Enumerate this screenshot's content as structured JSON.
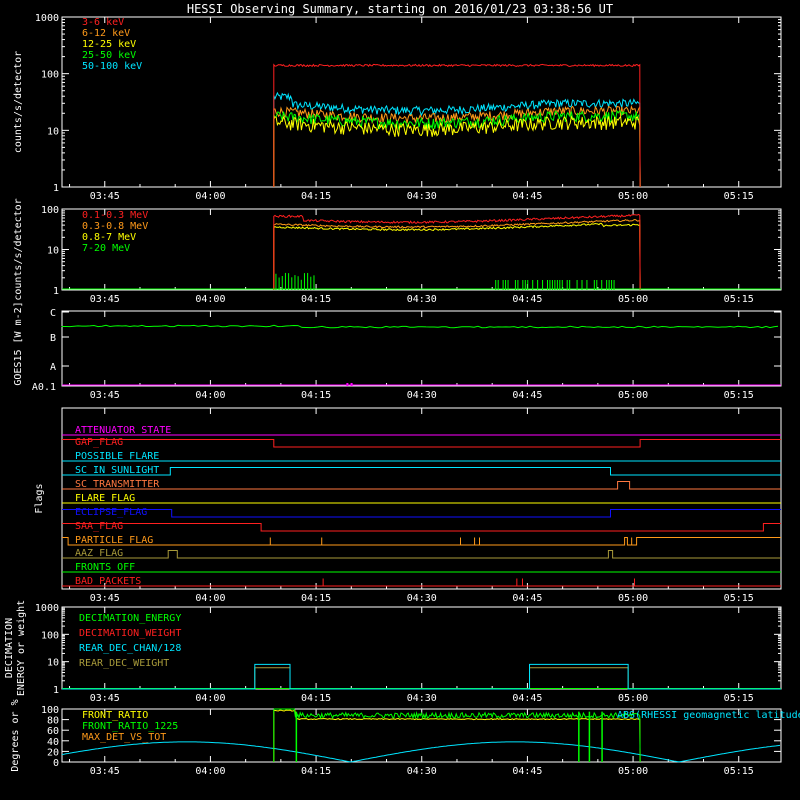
{
  "page": {
    "title": "HESSI Observing Summary, starting on 2016/01/23 03:38:56 UT"
  },
  "colors": {
    "background": "#000000",
    "axes": "#ffffff",
    "red": "#ff2020",
    "orange": "#ff9a1a",
    "yellow": "#ffff00",
    "green": "#00ff00",
    "cyan": "#00e5ff",
    "magenta": "#ff00ff",
    "blue": "#1010ff",
    "olive": "#a89a3a",
    "coral": "#ff7840"
  },
  "chart_data": [
    {
      "id": "lightcurve-low",
      "type": "line",
      "ylabel": "counts/s/detector",
      "yscale": "log",
      "ylim": [
        1,
        1000
      ],
      "yticks": [
        "1",
        "10",
        "100",
        "1000"
      ],
      "xticks": [
        "03:45",
        "04:00",
        "04:15",
        "04:30",
        "04:45",
        "05:00",
        "05:15"
      ],
      "xlim_minutes": [
        218.93,
        321.0
      ],
      "data_window": [
        249.0,
        301.0
      ],
      "series": [
        {
          "name": "3-6 keV",
          "color": "#ff2020",
          "level": 140
        },
        {
          "name": "6-12 keV",
          "color": "#ff9a1a",
          "level": 22
        },
        {
          "name": "12-25 keV",
          "color": "#ffff00",
          "level": 14
        },
        {
          "name": "25-50 keV",
          "color": "#00ff00",
          "level": 18
        },
        {
          "name": "50-100 keV",
          "color": "#00e5ff",
          "level": 30
        }
      ]
    },
    {
      "id": "lightcurve-high",
      "type": "line",
      "ylabel": "counts/s/detector",
      "yscale": "log",
      "ylim": [
        1,
        100
      ],
      "yticks": [
        "1",
        "10",
        "100"
      ],
      "xticks": [
        "03:45",
        "04:00",
        "04:15",
        "04:30",
        "04:45",
        "05:00",
        "05:15"
      ],
      "series": [
        {
          "name": "0.1-0.3 MeV",
          "color": "#ff2020",
          "level": 55
        },
        {
          "name": "0.3-0.8 MeV",
          "color": "#ff9a1a",
          "level": 42
        },
        {
          "name": "0.8-7 MeV",
          "color": "#ffff00",
          "level": 36
        },
        {
          "name": "7-20 MeV",
          "color": "#00ff00",
          "level": 1
        }
      ]
    },
    {
      "id": "goes",
      "type": "line",
      "ylabel": "GOES15 [W m-2]",
      "yticks": [
        "A0.1",
        "A",
        "B",
        "C"
      ],
      "xticks": [
        "03:45",
        "04:00",
        "04:15",
        "04:30",
        "04:45",
        "05:00",
        "05:15"
      ]
    },
    {
      "id": "flags",
      "type": "line",
      "ylabel": "Flags",
      "xticks": [
        "03:45",
        "04:00",
        "04:15",
        "04:30",
        "04:45",
        "05:00",
        "05:15"
      ],
      "series": [
        {
          "name": "ATTENUATOR_STATE",
          "color": "#ff00ff"
        },
        {
          "name": "GAP_FLAG",
          "color": "#ff2020"
        },
        {
          "name": "POSSIBLE_FLARE",
          "color": "#00e5ff"
        },
        {
          "name": "SC_IN_SUNLIGHT",
          "color": "#00e5ff"
        },
        {
          "name": "SC_TRANSMITTER",
          "color": "#ff7840"
        },
        {
          "name": "FLARE_FLAG",
          "color": "#ffff00"
        },
        {
          "name": "ECLIPSE_FLAG",
          "color": "#1010ff"
        },
        {
          "name": "SAA_FLAG",
          "color": "#ff2020"
        },
        {
          "name": "PARTICLE_FLAG",
          "color": "#ff9a1a"
        },
        {
          "name": "AAZ_FLAG",
          "color": "#a89a3a"
        },
        {
          "name": "FRONTS_OFF",
          "color": "#00ff00"
        },
        {
          "name": "BAD_PACKETS",
          "color": "#ff2020"
        }
      ]
    },
    {
      "id": "decimation",
      "type": "line",
      "ylabel": "DECIMATION ENERGY or weight",
      "yscale": "log",
      "ylim": [
        1,
        1000
      ],
      "yticks": [
        "1",
        "10",
        "100",
        "1000"
      ],
      "xticks": [
        "03:45",
        "04:00",
        "04:15",
        "04:30",
        "04:45",
        "05:00",
        "05:15"
      ],
      "series": [
        {
          "name": "DECIMATION_ENERGY",
          "color": "#00ff00"
        },
        {
          "name": "DECIMATION_WEIGHT",
          "color": "#ff2020"
        },
        {
          "name": "REAR_DEC_CHAN/128",
          "color": "#00e5ff"
        },
        {
          "name": "REAR_DEC_WEIGHT",
          "color": "#a89a3a"
        }
      ]
    },
    {
      "id": "ratios",
      "type": "line",
      "ylabel": "Degrees or %",
      "ylim": [
        0,
        100
      ],
      "yticks": [
        "0",
        "20",
        "40",
        "60",
        "80",
        "100"
      ],
      "xticks": [
        "03:45",
        "04:00",
        "04:15",
        "04:30",
        "04:45",
        "05:00",
        "05:15"
      ],
      "series": [
        {
          "name": "FRONT_RATIO",
          "color": "#ffff00"
        },
        {
          "name": "FRONT_RATIO_1225",
          "color": "#00ff00"
        },
        {
          "name": "MAX_DET_VS_TOT",
          "color": "#ff9a1a"
        },
        {
          "name": "ABS(RHESSI geomagnetic latitude",
          "color": "#00e5ff"
        }
      ]
    }
  ]
}
